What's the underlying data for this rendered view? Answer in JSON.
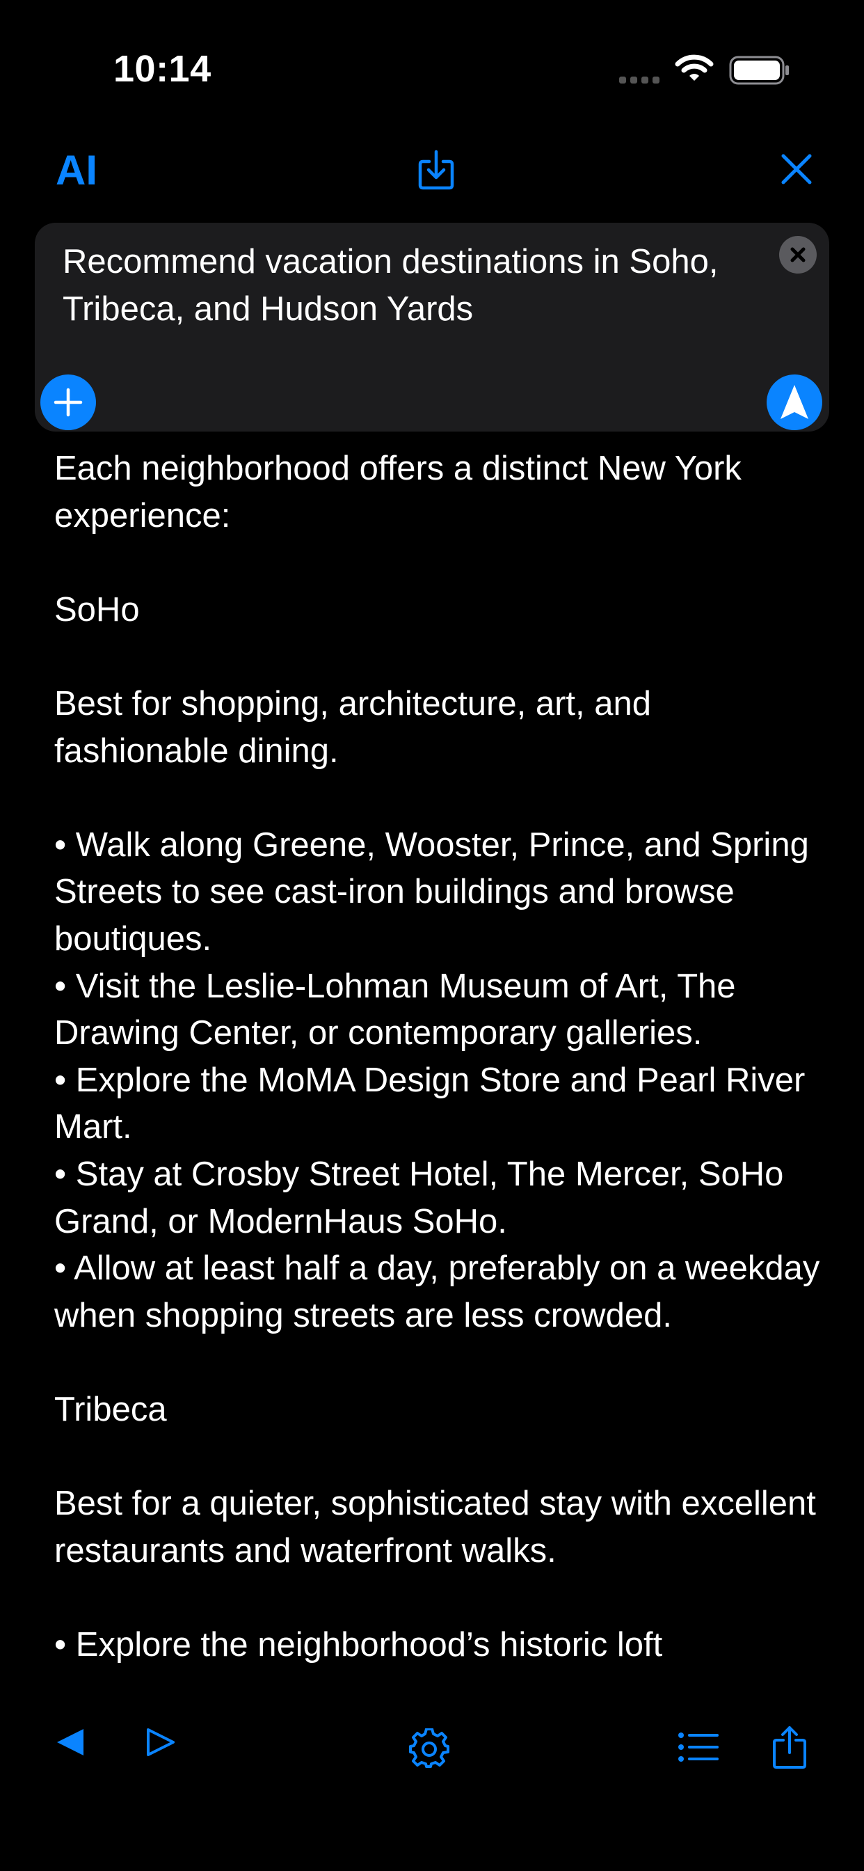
{
  "status_bar": {
    "time": "10:14"
  },
  "nav": {
    "title": "AI"
  },
  "query": {
    "text": "Recommend vacation destinations in Soho, Tribeca, and Hudson Yards"
  },
  "response": {
    "text": "Each neighborhood offers a distinct New York experience:\n\nSoHo\n\nBest for shopping, architecture, art, and fashionable dining.\n\n• Walk along Greene, Wooster, Prince, and Spring Streets to see cast-iron buildings and browse boutiques.\n• Visit the Leslie-Lohman Museum of Art, The Drawing Center, or contemporary galleries.\n• Explore the MoMA Design Store and Pearl River Mart.\n• Stay at Crosby Street Hotel, The Mercer, SoHo Grand, or ModernHaus SoHo.\n• Allow at least half a day, preferably on a weekday when shopping streets are less crowded.\n\nTribeca\n\nBest for a quieter, sophisticated stay with excellent restaurants and waterfront walks.\n\n• Explore the neighborhood’s historic loft"
  },
  "icons": {
    "status": [
      "cellular-signal-icon",
      "wifi-icon",
      "battery-icon"
    ],
    "nav": [
      "download-icon",
      "close-icon"
    ],
    "query": [
      "clear-icon",
      "plus-icon",
      "send-arrow-icon"
    ],
    "toolbar": [
      "back-triangle-icon",
      "forward-triangle-icon",
      "gear-icon",
      "list-icon",
      "share-icon"
    ]
  },
  "colors": {
    "accent": "#0a84ff",
    "background": "#000000",
    "input_background": "#1c1c1e"
  }
}
